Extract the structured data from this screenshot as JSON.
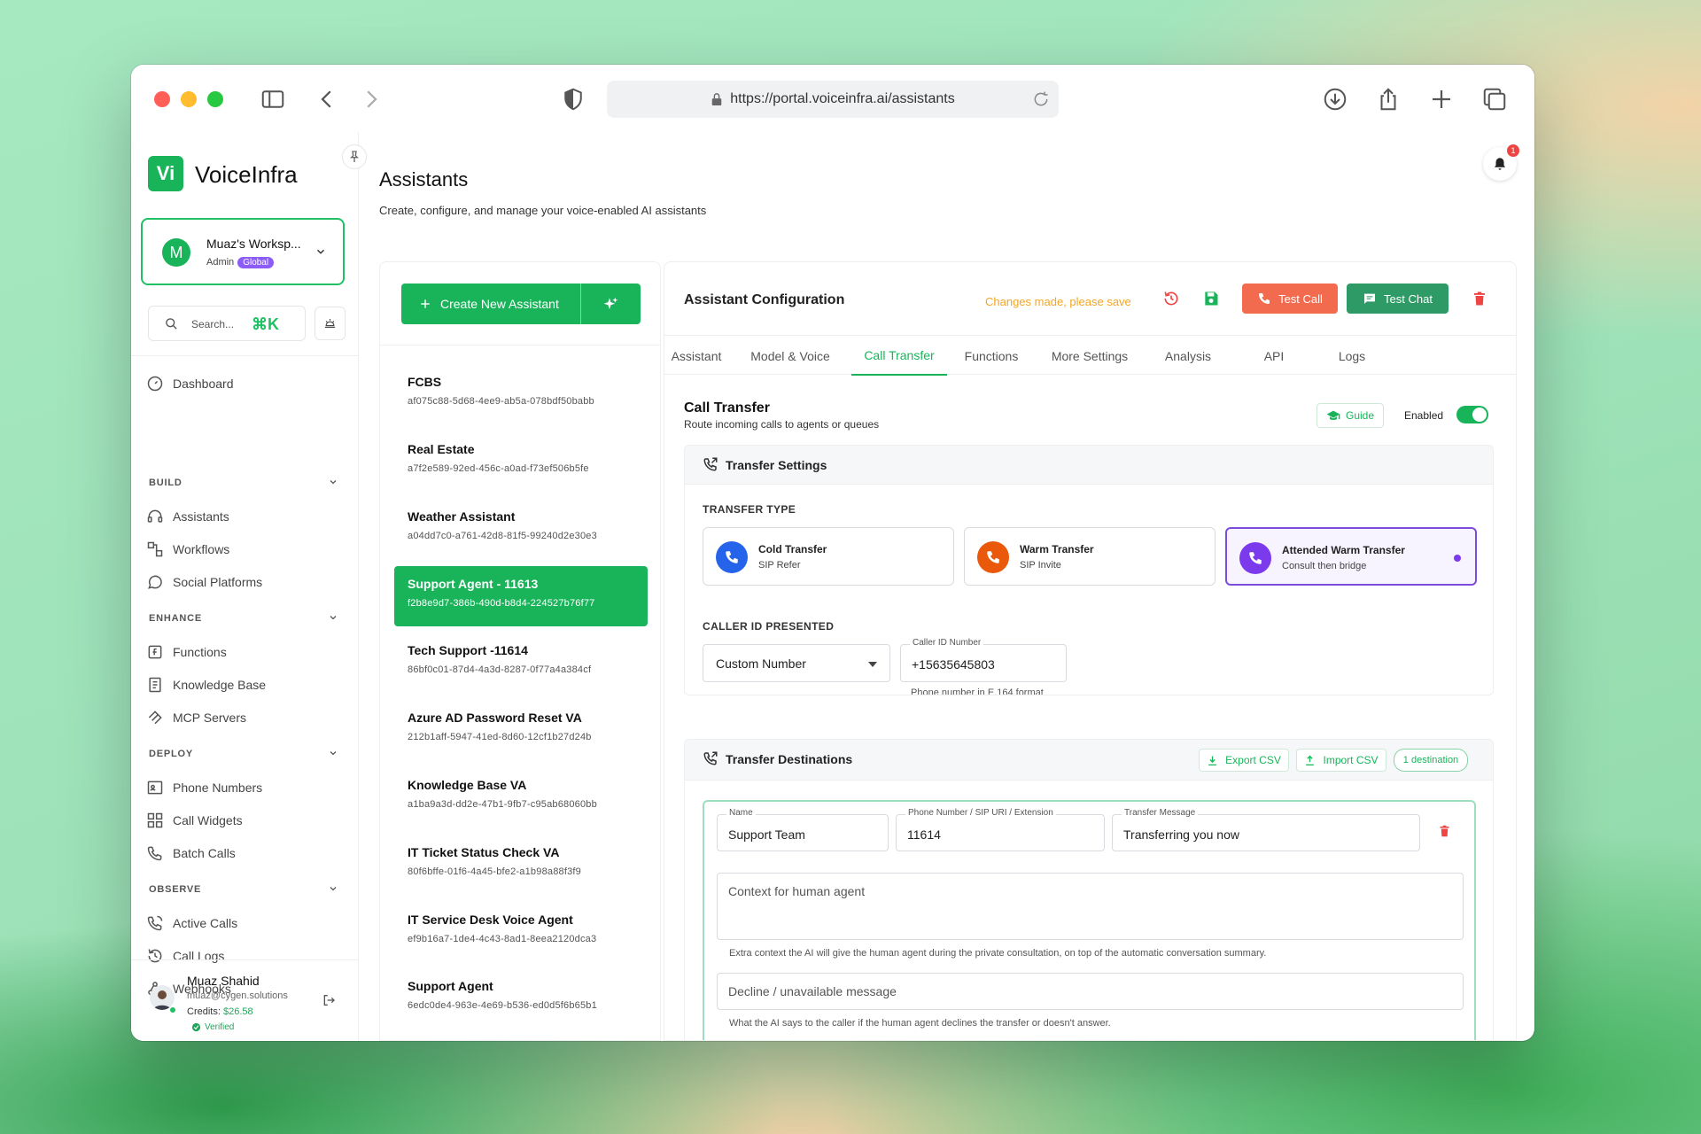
{
  "browser": {
    "url": "https://portal.voiceinfra.ai/assistants"
  },
  "sidebar": {
    "logo_text": "Vi",
    "brand": "VoiceInfra",
    "workspace": {
      "initial": "M",
      "name": "Muaz's Worksp...",
      "role": "Admin",
      "badge": "Global"
    },
    "search": {
      "placeholder": "Search...",
      "shortcut": "⌘K"
    },
    "dashboard": "Dashboard",
    "sections": [
      {
        "title": "BUILD",
        "items": [
          "Assistants",
          "Workflows",
          "Social Platforms"
        ]
      },
      {
        "title": "ENHANCE",
        "items": [
          "Functions",
          "Knowledge Base",
          "MCP Servers"
        ]
      },
      {
        "title": "DEPLOY",
        "items": [
          "Phone Numbers",
          "Call Widgets",
          "Batch Calls"
        ]
      },
      {
        "title": "OBSERVE",
        "items": [
          "Active Calls",
          "Call Logs",
          "Webhooks"
        ]
      }
    ],
    "user": {
      "name": "Muaz Shahid",
      "email": "muaz@cygen.solutions",
      "credits_label": "Credits:",
      "credits_value": "$26.58",
      "verified": "Verified"
    }
  },
  "header": {
    "title": "Assistants",
    "subtitle": "Create, configure, and manage your voice-enabled AI assistants",
    "notifications": "1"
  },
  "assistant_list": {
    "create_label": "Create New Assistant",
    "items": [
      {
        "name": "FCBS",
        "id": "af075c88-5d68-4ee9-ab5a-078bdf50babb"
      },
      {
        "name": "Real Estate",
        "id": "a7f2e589-92ed-456c-a0ad-f73ef506b5fe"
      },
      {
        "name": "Weather Assistant",
        "id": "a04dd7c0-a761-42d8-81f5-99240d2e30e3"
      },
      {
        "name": "Support Agent - 11613",
        "id": "f2b8e9d7-386b-490d-b8d4-224527b76f77"
      },
      {
        "name": "Tech Support -11614",
        "id": "86bf0c01-87d4-4a3d-8287-0f77a4a384cf"
      },
      {
        "name": "Azure AD Password Reset VA",
        "id": "212b1aff-5947-41ed-8d60-12cf1b27d24b"
      },
      {
        "name": "Knowledge Base VA",
        "id": "a1ba9a3d-dd2e-47b1-9fb7-c95ab68060bb"
      },
      {
        "name": "IT Ticket Status Check VA",
        "id": "80f6bffe-01f6-4a45-bfe2-a1b98a88f3f9"
      },
      {
        "name": "IT Service Desk Voice Agent",
        "id": "ef9b16a7-1de4-4c43-8ad1-8eea2120dca3"
      },
      {
        "name": "Support Agent",
        "id": "6edc0de4-963e-4e69-b536-ed0d5f6b65b1"
      }
    ],
    "selected_index": 3
  },
  "config": {
    "title": "Assistant Configuration",
    "unsaved_msg": "Changes made, please save",
    "test_call": "Test Call",
    "test_chat": "Test Chat",
    "tabs": [
      "Assistant",
      "Model & Voice",
      "Call Transfer",
      "Functions",
      "More Settings",
      "Analysis",
      "API",
      "Logs"
    ],
    "active_tab": "Call Transfer",
    "section_title": "Call Transfer",
    "section_sub": "Route incoming calls to agents or queues",
    "guide": "Guide",
    "enabled_label": "Enabled",
    "enabled": true,
    "transfer_settings": {
      "title": "Transfer Settings",
      "type_label": "TRANSFER TYPE",
      "types": [
        {
          "name": "Cold Transfer",
          "desc": "SIP Refer",
          "color": "#2563eb"
        },
        {
          "name": "Warm Transfer",
          "desc": "SIP Invite",
          "color": "#ea580c"
        },
        {
          "name": "Attended Warm Transfer",
          "desc": "Consult then bridge",
          "color": "#7c3aed"
        }
      ],
      "selected_type": "Attended Warm Transfer",
      "caller_id_label": "CALLER ID PRESENTED",
      "caller_id_mode": "Custom Number",
      "caller_id_number_label": "Caller ID Number",
      "caller_id_number": "+15635645803",
      "caller_id_help": "Phone number in E.164 format"
    },
    "destinations": {
      "title": "Transfer Destinations",
      "export": "Export CSV",
      "import": "Import CSV",
      "count": "1 destination",
      "row": {
        "name_label": "Name",
        "name": "Support Team",
        "phone_label": "Phone Number / SIP URI / Extension",
        "phone": "11614",
        "msg_label": "Transfer Message",
        "msg": "Transferring you now"
      },
      "context_placeholder": "Context for human agent",
      "context_help": "Extra context the AI will give the human agent during the private consultation, on top of the automatic conversation summary.",
      "decline_placeholder": "Decline / unavailable message",
      "decline_help": "What the AI says to the caller if the human agent declines the transfer or doesn't answer."
    }
  }
}
